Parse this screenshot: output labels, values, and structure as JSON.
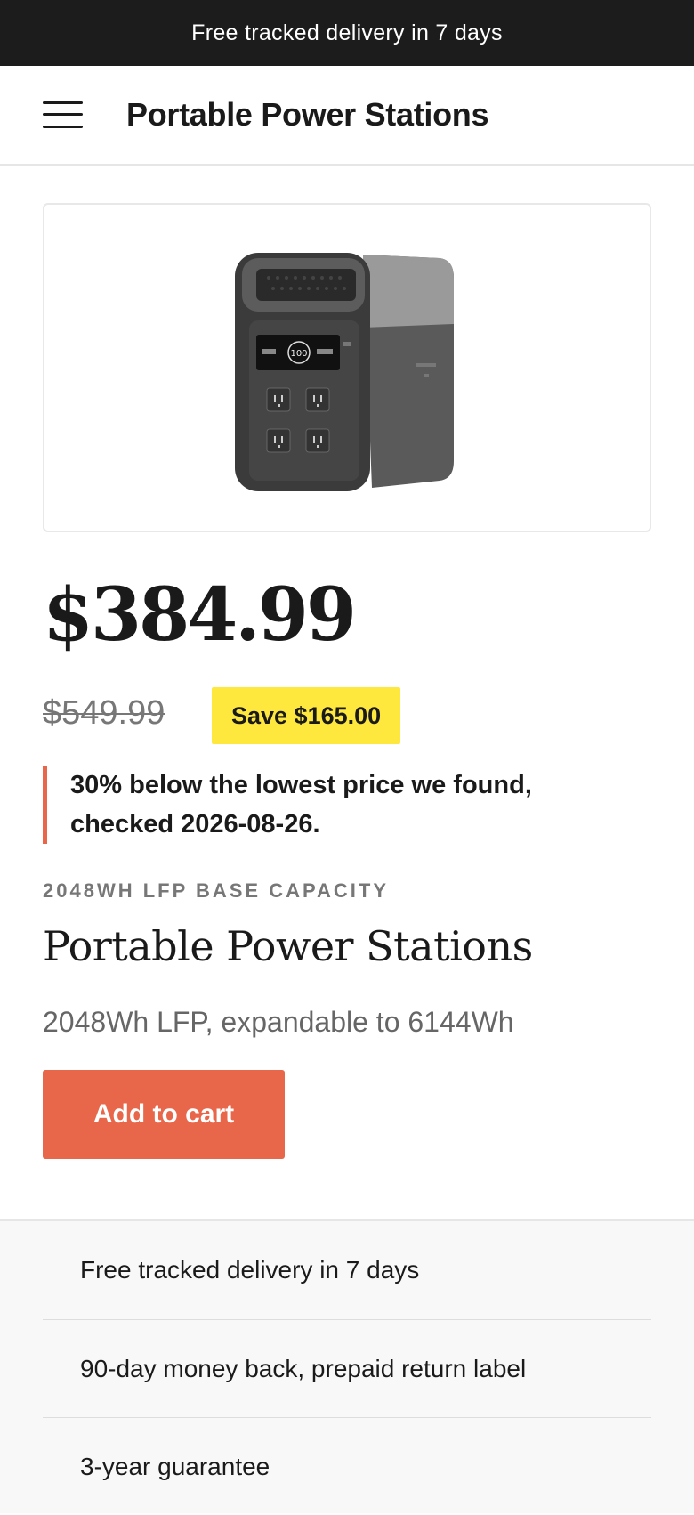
{
  "promo": {
    "text": "Free tracked delivery in 7 days"
  },
  "header": {
    "title": "Portable Power Stations",
    "menu_icon": "hamburger-icon"
  },
  "product": {
    "image_alt": "Portable power station",
    "price": "$384.99",
    "old_price": "$549.99",
    "save_label": "Save $165.00",
    "price_note": "30% below the lowest price we found, checked 2026-08-26.",
    "eyebrow": "2048WH LFP BASE CAPACITY",
    "title": "Portable Power Stations",
    "subtitle": "2048Wh LFP, expandable to 6144Wh",
    "add_to_cart_label": "Add to cart",
    "display_readout": "100"
  },
  "benefits": [
    "Free tracked delivery in 7 days",
    "90-day money back, prepaid return label",
    "3-year guarantee"
  ],
  "colors": {
    "accent": "#e8664a",
    "badge": "#ffe83d",
    "promo_bg": "#1c1c1c"
  }
}
